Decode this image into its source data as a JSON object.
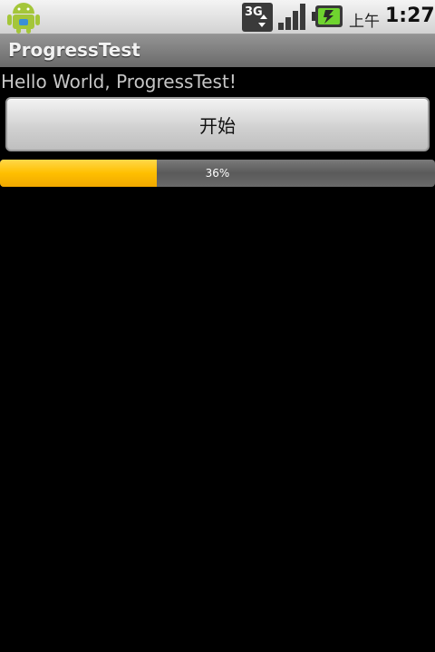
{
  "status_bar": {
    "app_icon": "android-robot-icon",
    "network_icon": "3g-data-icon",
    "network_label": "3G",
    "signal_icon": "signal-strength-icon",
    "battery_icon": "battery-charging-icon",
    "ampm": "上午",
    "time": "1:27"
  },
  "title_bar": {
    "title": "ProgressTest"
  },
  "content": {
    "hello_text": "Hello World, ProgressTest!",
    "start_button_label": "开始",
    "progress": {
      "value": 36,
      "label": "36%",
      "fill_color": "#ffbf00",
      "track_color": "#6a6a6a"
    }
  }
}
